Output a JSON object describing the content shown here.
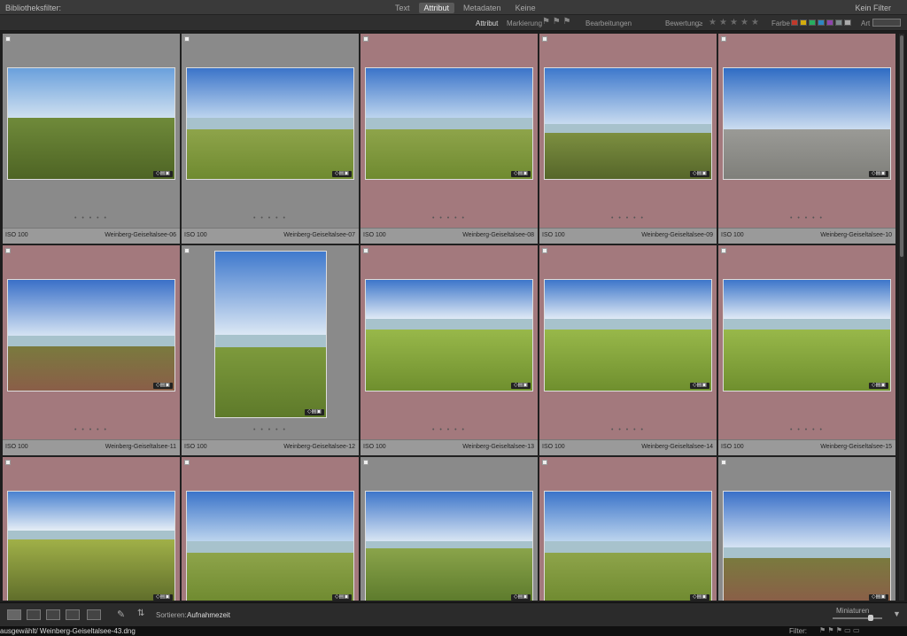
{
  "library_filter": {
    "title": "Bibliotheksfilter:",
    "tabs": [
      "Text",
      "Attribut",
      "Metadaten",
      "Keine"
    ],
    "active_tab": 1,
    "preset": "Kein Filter"
  },
  "attribute_bar": {
    "label": "Attribut",
    "markierung": "Markierung",
    "bearbeitungen": "Bearbeitungen",
    "bewertung": "Bewertung",
    "bewertung_op": "≥",
    "farbe": "Farbe",
    "art": "Art",
    "color_swatches": [
      "#c0392b",
      "#d4ac0d",
      "#27ae60",
      "#2e86c1",
      "#8e44ad",
      "#7f8c8d",
      "#aaaaaa"
    ]
  },
  "grid": {
    "cells": [
      {
        "iso": "ISO 100",
        "filename": "Weinberg-Geiseltalsee-06",
        "bg": "gray",
        "scene": "road"
      },
      {
        "iso": "ISO 100",
        "filename": "Weinberg-Geiseltalsee-07",
        "bg": "gray",
        "scene": "lake"
      },
      {
        "iso": "ISO 100",
        "filename": "Weinberg-Geiseltalsee-08",
        "bg": "red",
        "scene": "lake"
      },
      {
        "iso": "ISO 100",
        "filename": "Weinberg-Geiseltalsee-09",
        "bg": "red",
        "scene": "fence"
      },
      {
        "iso": "ISO 100",
        "filename": "Weinberg-Geiseltalsee-10",
        "bg": "red",
        "scene": "chapel"
      },
      {
        "iso": "ISO 100",
        "filename": "Weinberg-Geiseltalsee-11",
        "bg": "red",
        "scene": "tree"
      },
      {
        "iso": "ISO 100",
        "filename": "Weinberg-Geiseltalsee-12",
        "bg": "gray",
        "scene": "portrait"
      },
      {
        "iso": "ISO 100",
        "filename": "Weinberg-Geiseltalsee-13",
        "bg": "red",
        "scene": "vine"
      },
      {
        "iso": "ISO 100",
        "filename": "Weinberg-Geiseltalsee-14",
        "bg": "red",
        "scene": "vine"
      },
      {
        "iso": "ISO 100",
        "filename": "Weinberg-Geiseltalsee-15",
        "bg": "red",
        "scene": "vine"
      },
      {
        "iso": "",
        "filename": "",
        "bg": "red",
        "scene": "vinecloseup"
      },
      {
        "iso": "",
        "filename": "",
        "bg": "red",
        "scene": "lake"
      },
      {
        "iso": "",
        "filename": "",
        "bg": "gray",
        "scene": "post"
      },
      {
        "iso": "",
        "filename": "",
        "bg": "red",
        "scene": "lake"
      },
      {
        "iso": "",
        "filename": "",
        "bg": "gray",
        "scene": "tree"
      }
    ]
  },
  "toolbar": {
    "sort_label": "Sortieren:",
    "sort_value": "Aufnahmezeit",
    "thumb_label": "Miniaturen"
  },
  "status": {
    "selection": "ausgewählt/ Weinberg-Geiseltalsee-43.dng",
    "filter_label": "Filter:"
  }
}
